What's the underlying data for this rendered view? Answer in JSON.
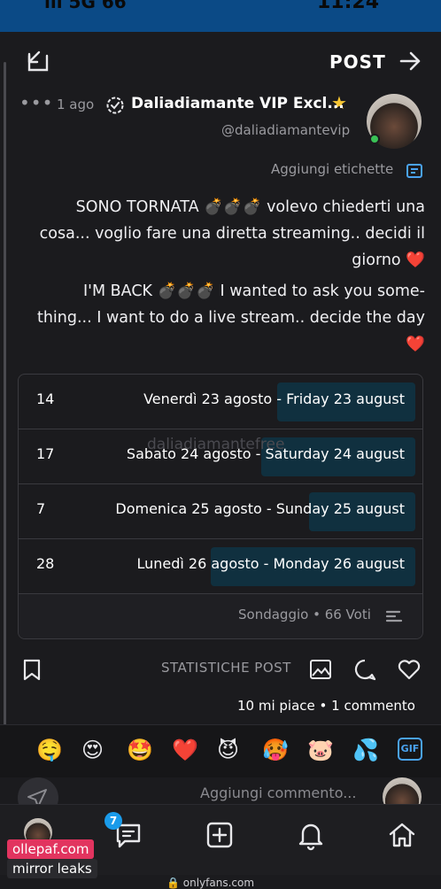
{
  "status_bar": {
    "left": "ııl 5G 66",
    "right": "11:24"
  },
  "header": {
    "title": "POST"
  },
  "post": {
    "author_name": "Daliadiamante VIP Excl...",
    "ago": "1 ago",
    "handle": "@daliadiamantevip",
    "add_tags": "Aggiungi etichette",
    "text_it": "SONO TORNATA 💣💣💣 volevo chiederti una cosa... voglio fare una diretta streaming.. decidi il giorno ❤️",
    "text_en": "I'M BACK 💣💣💣 I wanted to ask you some-thing... I want to do a live stream.. decide the day ❤️",
    "watermark": "daliadiamantefree"
  },
  "poll": {
    "options": [
      {
        "label": "Venerdì 23 agosto - Friday 23 august",
        "votes": "14",
        "fraction": 0.21
      },
      {
        "label": "Sabato 24 agosto - Saturday 24 august",
        "votes": "17",
        "fraction": 0.26
      },
      {
        "label": "Domenica 25 agosto - Sunday 25 august",
        "votes": "7",
        "fraction": 0.11
      },
      {
        "label": "Lunedì 26 agosto - Monday 26 august",
        "votes": "28",
        "fraction": 0.42
      }
    ],
    "footer": "Sondaggio • 66 Voti"
  },
  "actions": {
    "stats_label": "STATISTICHE POST"
  },
  "meta": {
    "line": "10 mi piace • 1 commento"
  },
  "reactions": {
    "gif_label": "GIF",
    "emojis": [
      "💦",
      "🐷",
      "🥵",
      "😈",
      "❤️",
      "🤩",
      "😍",
      "🤤"
    ]
  },
  "comment": {
    "placeholder": "Aggiungi commento..."
  },
  "nav": {
    "badge_count": "7"
  },
  "url": {
    "text": "🔒 onlyfans.com"
  },
  "overlay": {
    "line1": "ollepaf.com",
    "line2": "mirror leaks"
  },
  "colors": {
    "accent": "#1a9bea",
    "poll_fill": "#10303f",
    "background": "#1b1b1e",
    "online": "#3ac256",
    "heart": "#e31b23"
  }
}
